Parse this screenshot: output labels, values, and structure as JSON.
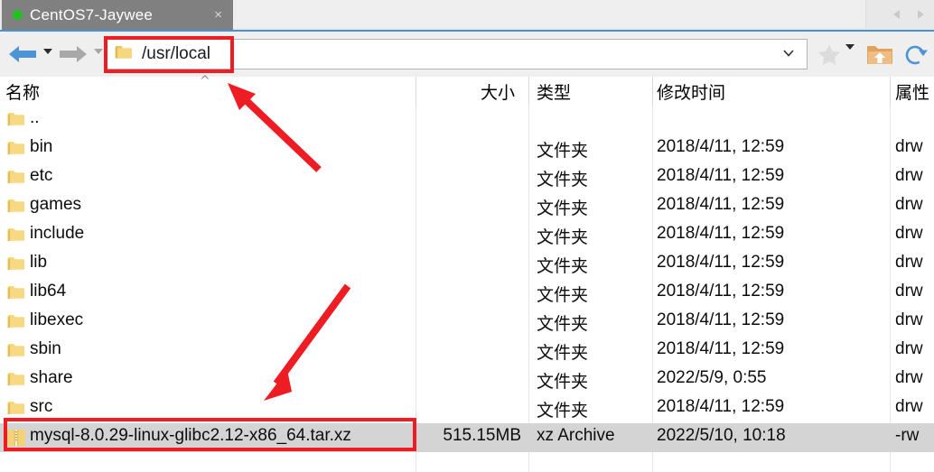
{
  "window": {
    "tab": {
      "label": "CentOS7-Jaywee",
      "status_dot_color": "#22c022",
      "close_glyph": "×"
    },
    "tab_scroll_left": "scroll-left-icon",
    "tab_scroll_right": "scroll-right-icon"
  },
  "toolbar": {
    "back_icon": "back-arrow-icon",
    "back_dropdown": "back-dropdown-caret",
    "forward_icon": "forward-arrow-icon",
    "forward_dropdown": "forward-dropdown-caret",
    "address": {
      "value": "/usr/local",
      "placeholder": "/usr/local",
      "folder_icon": "folder-icon",
      "chevron_icon": "chevron-down-icon"
    },
    "bookmark_icon": "star-icon",
    "bookmark_dropdown": "bookmark-dropdown-caret",
    "upload_icon": "upload-folder-icon",
    "refresh_icon": "refresh-icon"
  },
  "columns": [
    {
      "key": "name",
      "label": "名称",
      "sort": "asc"
    },
    {
      "key": "size",
      "label": "大小"
    },
    {
      "key": "type",
      "label": "类型"
    },
    {
      "key": "date",
      "label": "修改时间"
    },
    {
      "key": "attr",
      "label": "属性"
    }
  ],
  "rows": [
    {
      "icon": "folder-icon",
      "name": "..",
      "size": "",
      "type": "",
      "date": "",
      "attr": "",
      "selected": false
    },
    {
      "icon": "folder-icon",
      "name": "bin",
      "size": "",
      "type": "文件夹",
      "date": "2018/4/11, 12:59",
      "attr": "drw",
      "selected": false
    },
    {
      "icon": "folder-icon",
      "name": "etc",
      "size": "",
      "type": "文件夹",
      "date": "2018/4/11, 12:59",
      "attr": "drw",
      "selected": false
    },
    {
      "icon": "folder-icon",
      "name": "games",
      "size": "",
      "type": "文件夹",
      "date": "2018/4/11, 12:59",
      "attr": "drw",
      "selected": false
    },
    {
      "icon": "folder-icon",
      "name": "include",
      "size": "",
      "type": "文件夹",
      "date": "2018/4/11, 12:59",
      "attr": "drw",
      "selected": false
    },
    {
      "icon": "folder-icon",
      "name": "lib",
      "size": "",
      "type": "文件夹",
      "date": "2018/4/11, 12:59",
      "attr": "drw",
      "selected": false
    },
    {
      "icon": "folder-icon",
      "name": "lib64",
      "size": "",
      "type": "文件夹",
      "date": "2018/4/11, 12:59",
      "attr": "drw",
      "selected": false
    },
    {
      "icon": "folder-icon",
      "name": "libexec",
      "size": "",
      "type": "文件夹",
      "date": "2018/4/11, 12:59",
      "attr": "drw",
      "selected": false
    },
    {
      "icon": "folder-icon",
      "name": "sbin",
      "size": "",
      "type": "文件夹",
      "date": "2018/4/11, 12:59",
      "attr": "drw",
      "selected": false
    },
    {
      "icon": "folder-icon",
      "name": "share",
      "size": "",
      "type": "文件夹",
      "date": "2022/5/9, 0:55",
      "attr": "drw",
      "selected": false
    },
    {
      "icon": "folder-icon",
      "name": "src",
      "size": "",
      "type": "文件夹",
      "date": "2018/4/11, 12:59",
      "attr": "drw",
      "selected": false
    },
    {
      "icon": "archive-icon",
      "name": "mysql-8.0.29-linux-glibc2.12-x86_64.tar.xz",
      "size": "515.15MB",
      "type": "xz Archive",
      "date": "2022/5/10, 10:18",
      "attr": "-rw",
      "selected": true
    }
  ],
  "annotations": {
    "accent_color": "#ee1c23",
    "box_address_bar": "highlight-address-bar",
    "box_selected_file": "highlight-selected-file",
    "arrow_to_address_bar": "arrow-pointing-to-address-bar",
    "arrow_to_file": "arrow-pointing-to-file"
  }
}
